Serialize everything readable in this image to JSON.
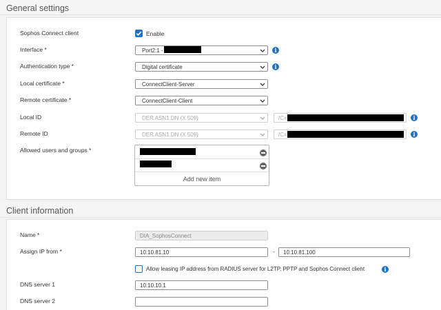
{
  "sections": {
    "general": "General settings",
    "client": "Client information"
  },
  "general": {
    "sophos_connect_label": "Sophos Connect client",
    "enable_label": "Enable",
    "enable_checked": true,
    "interface_label": "Interface *",
    "interface_value": "Port2:1 - 8",
    "auth_type_label": "Authentication type *",
    "auth_type_value": "Digital certificate",
    "local_cert_label": "Local certificate *",
    "local_cert_value": "ConnectClient-Server",
    "remote_cert_label": "Remote certificate *",
    "remote_cert_value": "ConnectClient-Client",
    "local_id_label": "Local ID",
    "local_id_type": "DER ASN1 DN (X.509)",
    "local_id_value": "/C=",
    "remote_id_label": "Remote ID",
    "remote_id_type": "DER ASN1 DN (X.509)",
    "remote_id_value": "/C=",
    "allowed_label": "Allowed users and groups *",
    "add_new_item": "Add new item"
  },
  "client": {
    "name_label": "Name *",
    "name_value": "DIA_SophosConnect",
    "assign_ip_label": "Assign IP from *",
    "ip_from": "10.10.81.10",
    "ip_sep": "-",
    "ip_to": "10.10.81.100",
    "radius_label": "Allow leasing IP address from RADIUS server for L2TP, PPTP and Sophos Connect client",
    "radius_checked": false,
    "dns1_label": "DNS server 1",
    "dns1_value": "10.10.10.1",
    "dns2_label": "DNS server 2",
    "dns2_value": ""
  },
  "icons": {
    "info": "info-icon",
    "chevron": "chevron-down-icon",
    "check": "checkmark-icon",
    "remove": "minus-circle-icon"
  },
  "colors": {
    "accent": "#1e73c6",
    "redaction": "#000000"
  }
}
